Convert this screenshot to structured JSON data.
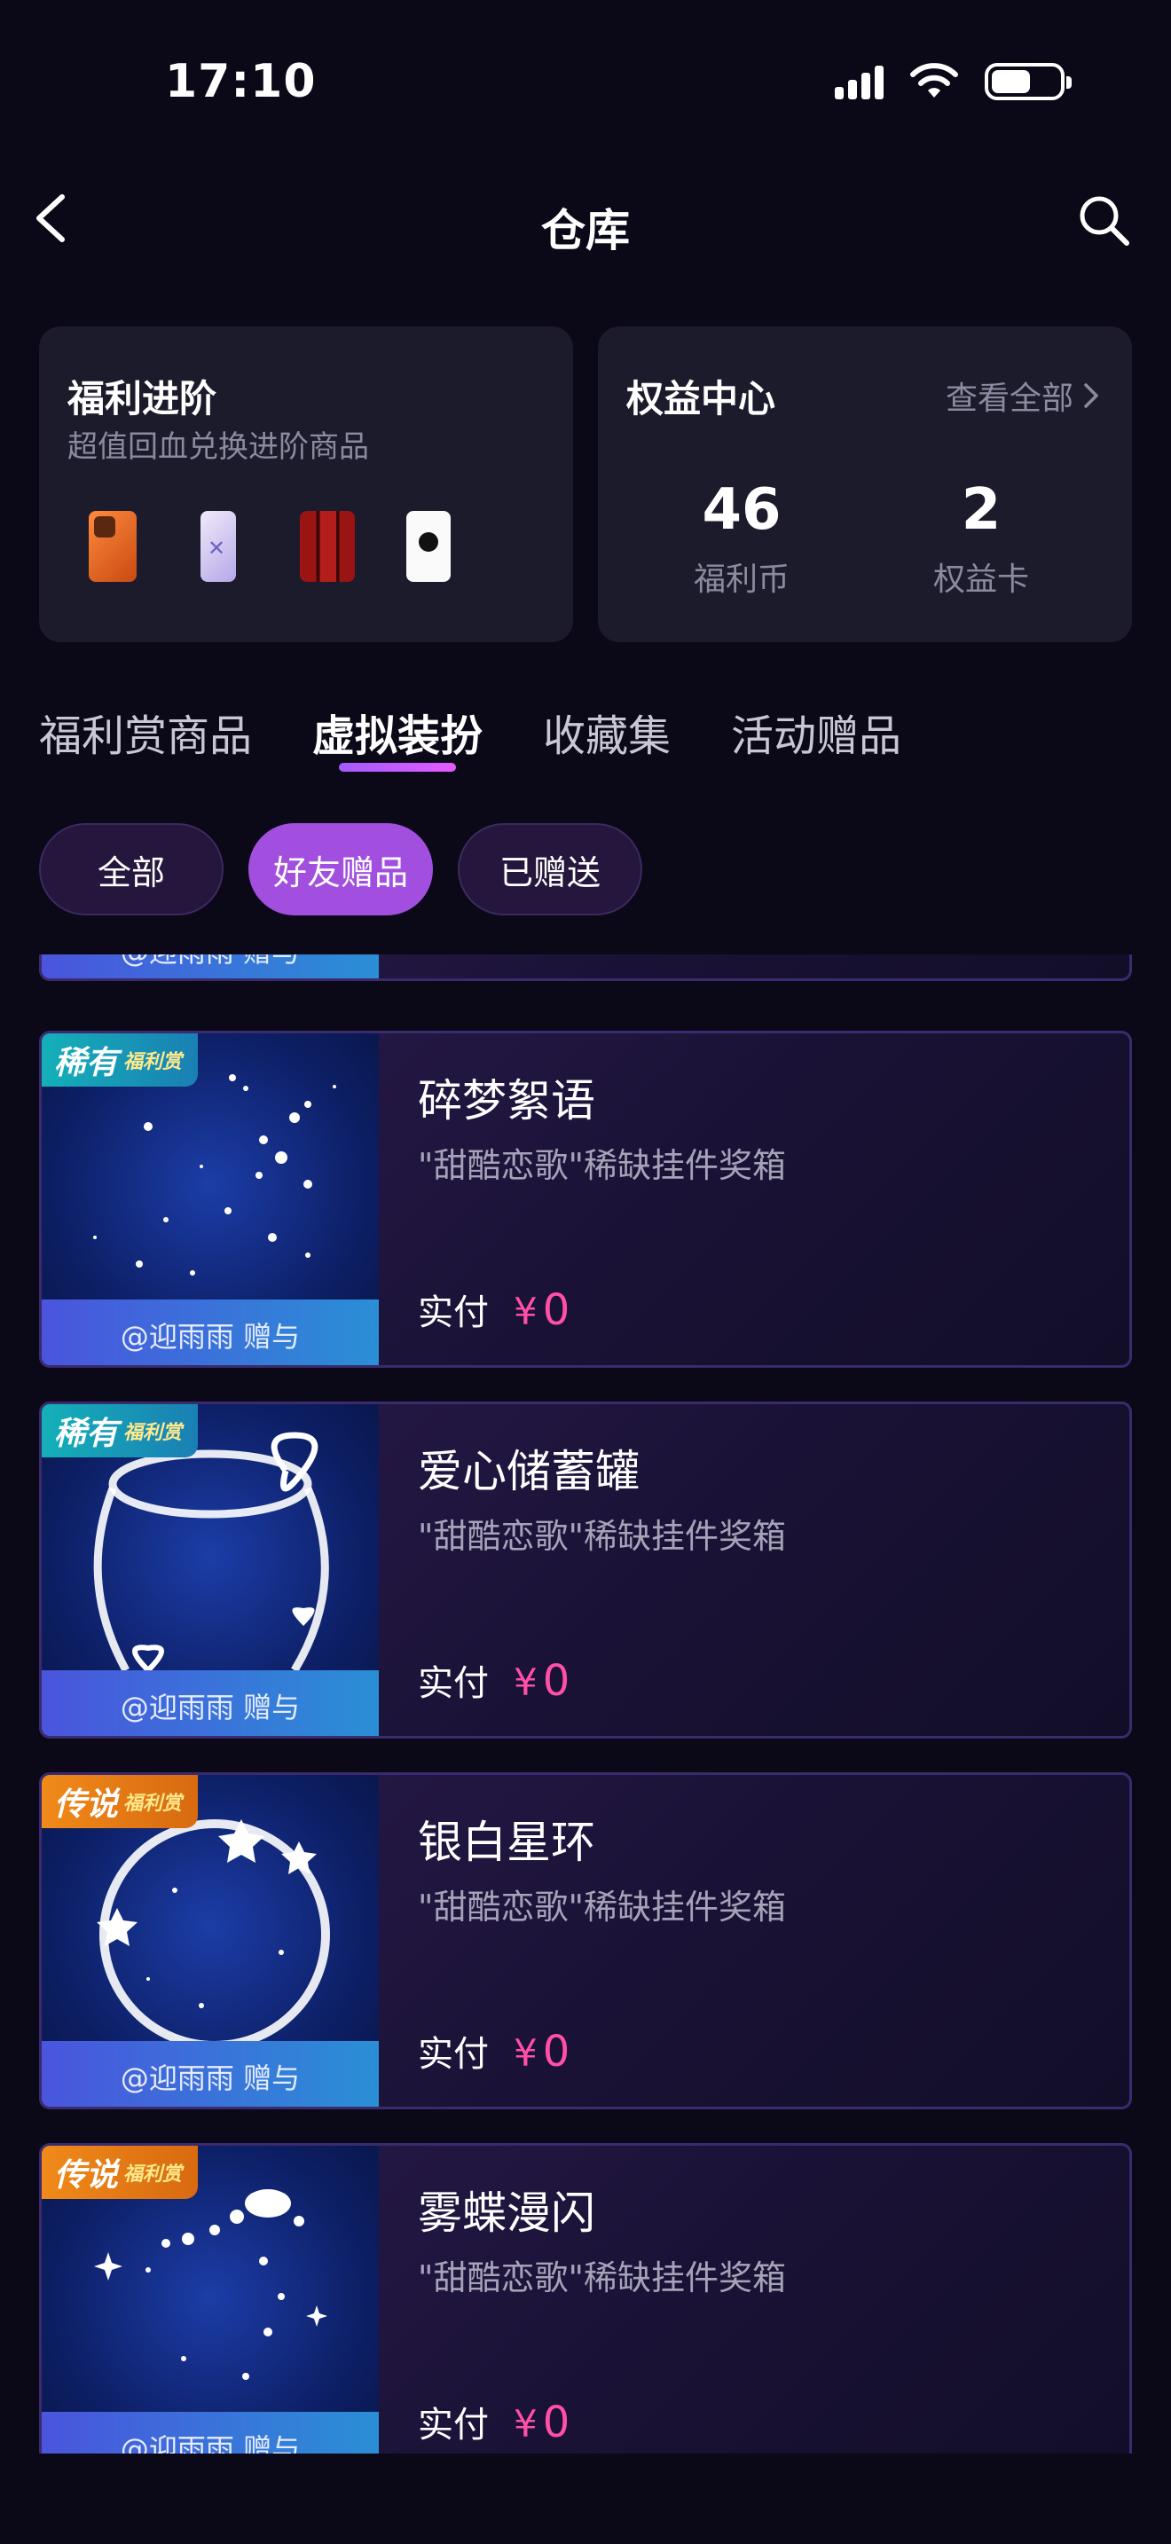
{
  "status_bar": {
    "time": "17:10"
  },
  "nav": {
    "title": "仓库"
  },
  "welfare_card": {
    "title": "福利进阶",
    "subtitle": "超值回血兑换进阶商品"
  },
  "rights_card": {
    "title": "权益中心",
    "view_all": "查看全部",
    "stats": [
      {
        "value": "46",
        "label": "福利币"
      },
      {
        "value": "2",
        "label": "权益卡"
      }
    ]
  },
  "main_tabs": [
    "福利赏商品",
    "虚拟装扮",
    "收藏集",
    "活动赠品"
  ],
  "active_main_tab": "虚拟装扮",
  "filters": [
    "全部",
    "好友赠品",
    "已赠送"
  ],
  "active_filter": "好友赠品",
  "colors": {
    "accent_purple": "#a24fe0",
    "price_pink": "#ff4fa6",
    "rare_badge": "#14b0b8",
    "legend_badge": "#f08a1a"
  },
  "items": [
    {
      "gifter": "@迎雨雨 赠与"
    },
    {
      "badge": "稀有",
      "badge_sub": "福利赏",
      "name": "碎梦絮语",
      "desc": "\"甜酷恋歌\"稀缺挂件奖箱",
      "pay_label": "实付",
      "currency": "¥",
      "price": "0",
      "gifter": "@迎雨雨 赠与"
    },
    {
      "badge": "稀有",
      "badge_sub": "福利赏",
      "name": "爱心储蓄罐",
      "desc": "\"甜酷恋歌\"稀缺挂件奖箱",
      "pay_label": "实付",
      "currency": "¥",
      "price": "0",
      "gifter": "@迎雨雨 赠与"
    },
    {
      "badge": "传说",
      "badge_sub": "福利赏",
      "name": "银白星环",
      "desc": "\"甜酷恋歌\"稀缺挂件奖箱",
      "pay_label": "实付",
      "currency": "¥",
      "price": "0",
      "gifter": "@迎雨雨 赠与"
    },
    {
      "badge": "传说",
      "badge_sub": "福利赏",
      "name": "雾蝶漫闪",
      "desc": "\"甜酷恋歌\"稀缺挂件奖箱",
      "pay_label": "实付",
      "currency": "¥",
      "price": "0",
      "gifter": "@迎雨雨 赠与"
    }
  ]
}
